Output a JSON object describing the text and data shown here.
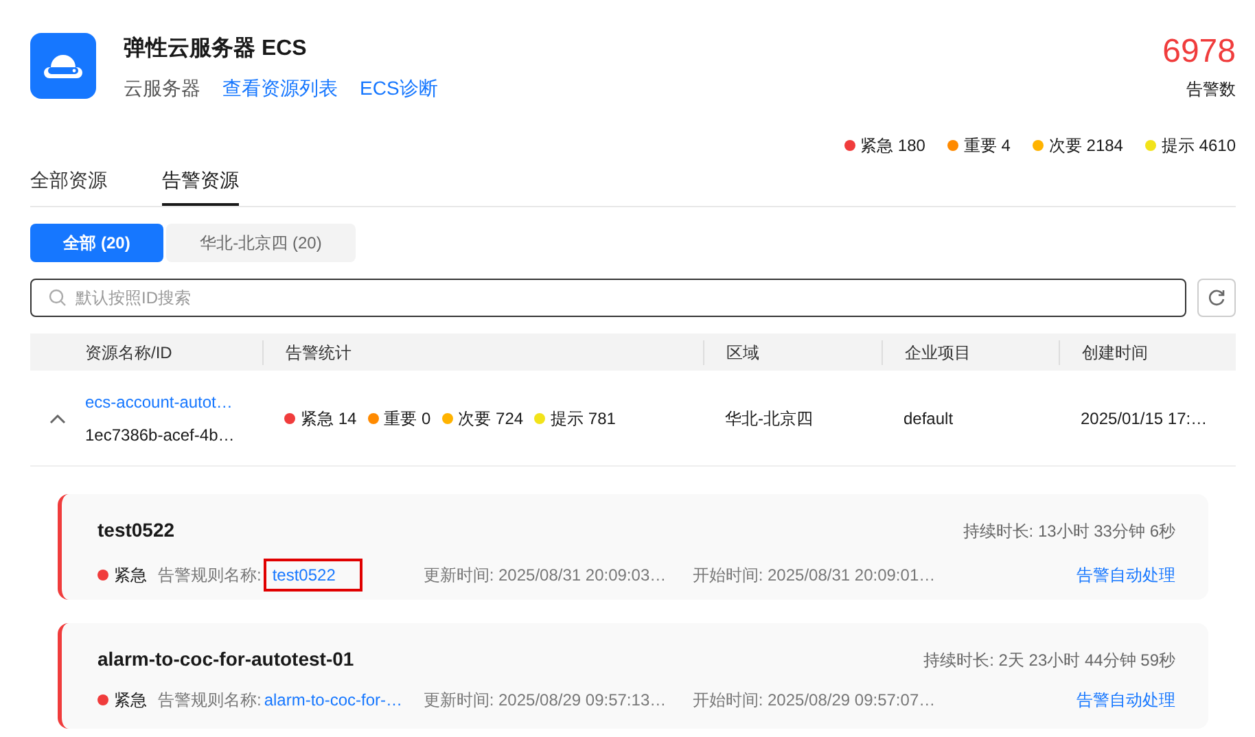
{
  "header": {
    "title": "弹性云服务器 ECS",
    "subtitle": "云服务器",
    "links": [
      "查看资源列表",
      "ECS诊断"
    ],
    "total": "6978",
    "total_label": "告警数"
  },
  "legend": [
    {
      "text": "紧急 180",
      "color": "#f03c3c"
    },
    {
      "text": "重要 4",
      "color": "#ff8a00"
    },
    {
      "text": "次要 2184",
      "color": "#ffb300"
    },
    {
      "text": "提示 4610",
      "color": "#f2e31a"
    }
  ],
  "tabs": [
    {
      "label": "全部资源",
      "selected": false
    },
    {
      "label": "告警资源",
      "selected": true
    }
  ],
  "filters": [
    {
      "label": "全部 (20)",
      "selected": true
    },
    {
      "label": "华北-北京四 (20)",
      "selected": false
    }
  ],
  "search": {
    "placeholder": "默认按照ID搜索"
  },
  "table": {
    "columns": [
      "资源名称/ID",
      "告警统计",
      "区域",
      "企业项目",
      "创建时间"
    ],
    "rows": [
      {
        "expanded": true,
        "name": "ecs-account-autot…",
        "id": "1ec7386b-acef-4b…",
        "stats": [
          {
            "text": "紧急 14",
            "color": "#f03c3c"
          },
          {
            "text": "重要 0",
            "color": "#ff8a00"
          },
          {
            "text": "次要 724",
            "color": "#ffb300"
          },
          {
            "text": "提示 781",
            "color": "#f2e31a"
          }
        ],
        "region": "华北-北京四",
        "project": "default",
        "created": "2025/01/15 17:…"
      }
    ]
  },
  "alarms": [
    {
      "title": "test0522",
      "severity": "紧急",
      "color": "#f03c3c",
      "rule_label": "告警规则名称:",
      "rule": "test0522",
      "highlighted": true,
      "updated": "更新时间: 2025/08/31 20:09:03…",
      "started": "开始时间: 2025/08/31 20:09:01…",
      "duration": "持续时长: 13小时 33分钟 6秒",
      "action": "告警自动处理"
    },
    {
      "title": "alarm-to-coc-for-autotest-01",
      "severity": "紧急",
      "color": "#f03c3c",
      "rule_label": "告警规则名称:",
      "rule": "alarm-to-coc-for-…",
      "highlighted": false,
      "updated": "更新时间: 2025/08/29 09:57:13…",
      "started": "开始时间: 2025/08/29 09:57:07…",
      "duration": "持续时长: 2天 23小时 44分钟 59秒",
      "action": "告警自动处理"
    }
  ]
}
